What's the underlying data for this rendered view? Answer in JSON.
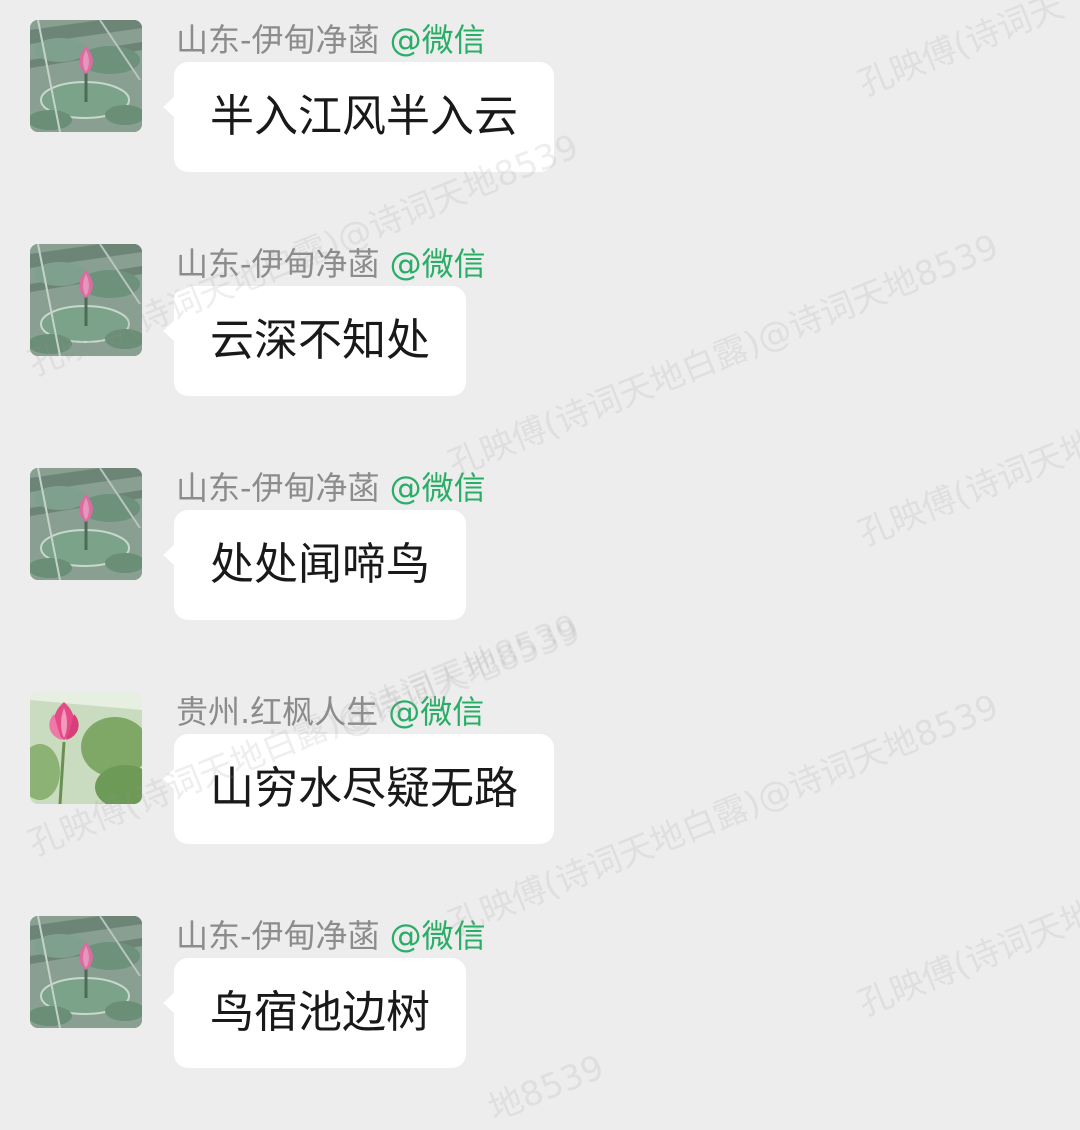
{
  "messages": [
    {
      "sender": "山东-伊甸净菡",
      "suffix": "@微信",
      "text": "半入江风半入云",
      "avatar_icon": "lotus-bud-avatar"
    },
    {
      "sender": "山东-伊甸净菡",
      "suffix": "@微信",
      "text": "云深不知处",
      "avatar_icon": "lotus-bud-avatar"
    },
    {
      "sender": "山东-伊甸净菡",
      "suffix": "@微信",
      "text": "处处闻啼鸟",
      "avatar_icon": "lotus-bud-avatar"
    },
    {
      "sender": "贵州.红枫人生",
      "suffix": "@微信",
      "text": "山穷水尽疑无路",
      "avatar_icon": "pink-lotus-avatar"
    },
    {
      "sender": "山东-伊甸净菡",
      "suffix": "@微信",
      "text": "鸟宿池边树",
      "avatar_icon": "lotus-bud-avatar"
    }
  ],
  "watermarks": [
    "孔映傅(诗词天",
    "孔映傅(诗词天地白露)@诗词天地8539",
    "孔映傅(诗词天地白露)@诗词天地8539",
    "孔映傅(诗词天地",
    "@诗词天地8539",
    "孔映傅(诗词天地白露)@诗词天地8539",
    "孔映傅(诗词天地白露)@诗词天地8539",
    "孔映傅(诗词天地",
    "地8539"
  ],
  "colors": {
    "background": "#ededed",
    "bubble": "#ffffff",
    "sender_name": "#8c8c8c",
    "wechat_suffix": "#2aae67",
    "message_text": "#191919"
  }
}
